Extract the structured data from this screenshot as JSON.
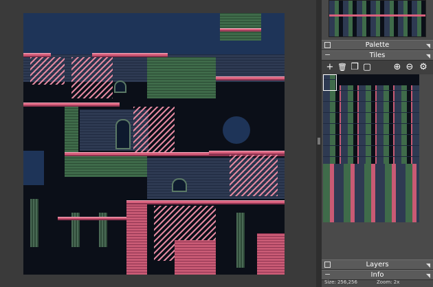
{
  "panels": {
    "palette": "Palette",
    "tiles": "Tiles",
    "layers": "Layers",
    "info": "Info"
  },
  "toolbar": {
    "add": "+",
    "delete": "🗑",
    "duplicate": "❐",
    "frame": "▢",
    "zoom_in": "⊕",
    "zoom_out": "⊖",
    "settings": "⚙"
  },
  "info": {
    "size": "Size: 256,256",
    "zoom": "Zoom: 2x"
  },
  "colors": {
    "background": "#3a3a3a",
    "panel": "#4a4a4a",
    "accent_pink": "#d9617d",
    "accent_green": "#3f6b4a"
  }
}
